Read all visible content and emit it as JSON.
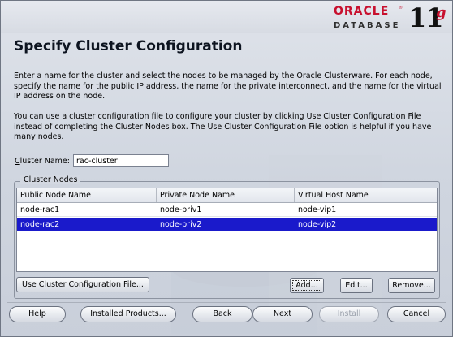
{
  "branding": {
    "oracle": "ORACLE",
    "reg": "®",
    "database": "DATABASE",
    "version": "11",
    "version_suffix": "g"
  },
  "title": "Specify Cluster Configuration",
  "intro": [
    "Enter a name for the cluster and select the nodes to be managed by the Oracle Clusterware.  For each node, specify the name for the public IP address, the name for the private interconnect, and the name for the virtual IP address on the node.",
    "You can use a cluster configuration file to configure your cluster by clicking Use Cluster Configuration File instead of completing the Cluster Nodes box. The Use Cluster Configuration File option is helpful if you have many nodes."
  ],
  "cluster_name": {
    "label_mnemonic": "C",
    "label_rest": "luster Name:",
    "value": "rac-cluster"
  },
  "cluster_nodes": {
    "legend": "Cluster Nodes",
    "columns": [
      "Public Node Name",
      "Private Node Name",
      "Virtual Host Name"
    ],
    "rows": [
      [
        "node-rac1",
        "node-priv1",
        "node-vip1"
      ],
      [
        "node-rac2",
        "node-priv2",
        "node-vip2"
      ]
    ],
    "selected_row": 2
  },
  "node_buttons": {
    "use_config_file": "Use Cluster Configuration File...",
    "add": "Add...",
    "edit": "Edit...",
    "remove": "Remove..."
  },
  "footer": {
    "help": "Help",
    "installed_products": "Installed Products...",
    "back": "Back",
    "next": "Next",
    "install": "Install",
    "cancel": "Cancel"
  }
}
